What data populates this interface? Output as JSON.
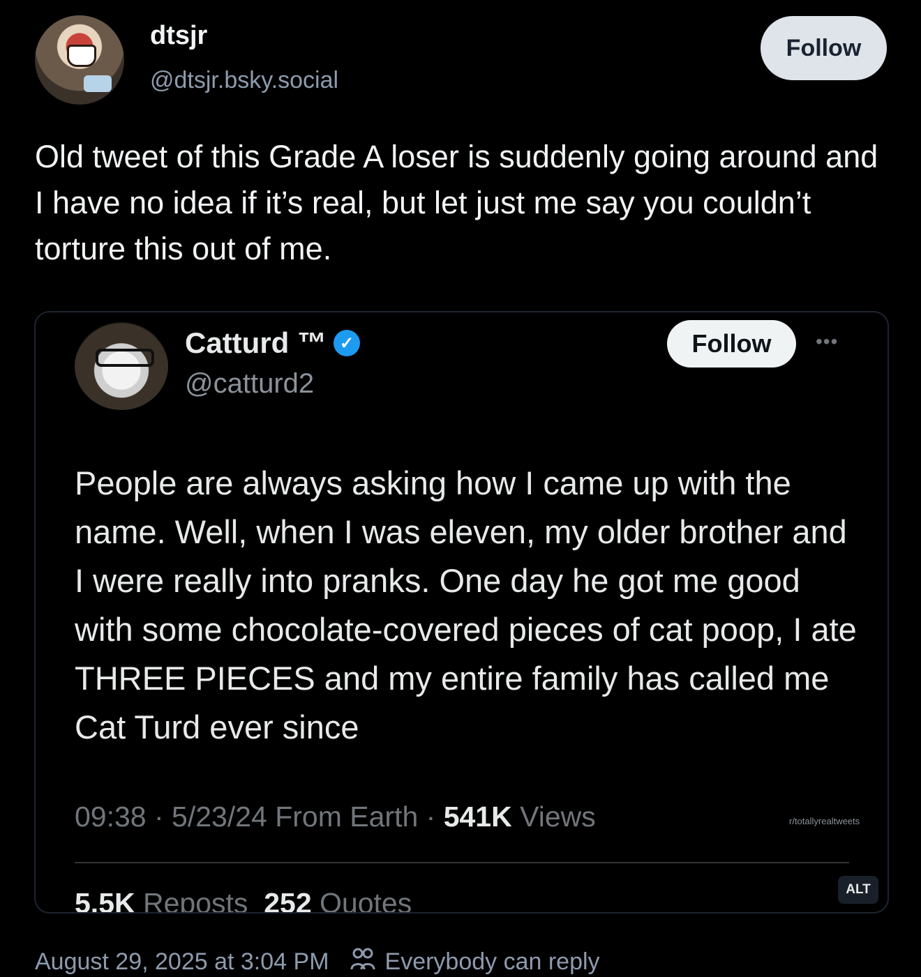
{
  "author": {
    "display_name": "dtsjr",
    "handle": "@dtsjr.bsky.social",
    "follow_label": "Follow"
  },
  "post": {
    "text": "Old tweet of this Grade A loser is suddenly going around and I have no idea if it’s real, but let just me say you couldn’t torture this out of me."
  },
  "embedded_tweet": {
    "display_name": "Catturd ™",
    "handle": "@catturd2",
    "follow_label": "Follow",
    "more_label": "•••",
    "text": "People are always asking how I came up with the name. Well, when I was eleven, my older brother and I were really into pranks. One day he got me good with some chocolate-covered pieces of cat poop, I ate THREE PIECES and my entire family has called me Cat Turd ever since",
    "meta_prefix": "09:38 · 5/23/24 From Earth · ",
    "views_count": "541K",
    "views_label": " Views",
    "watermark": "r/totallyrealtweets",
    "reposts_count": "5.5K",
    "reposts_label": " Reposts",
    "quotes_count": "252",
    "quotes_label": " Quotes",
    "alt_label": "ALT"
  },
  "footer": {
    "timestamp": "August 29, 2025 at 3:04 PM",
    "reply_setting": "Everybody can reply"
  },
  "colors": {
    "background": "#000000",
    "follow_button_bg": "#dfe4ea",
    "verified": "#1d9bf0",
    "muted_text": "#8e9bae"
  }
}
